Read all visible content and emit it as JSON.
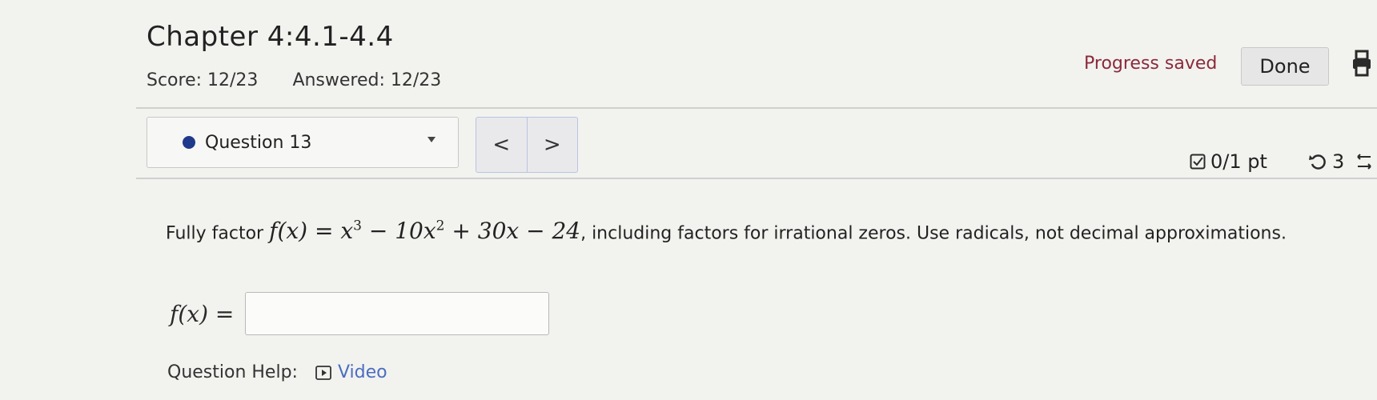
{
  "header": {
    "title": "Chapter 4:4.1-4.4",
    "score": "Score: 12/23",
    "answered": "Answered: 12/23",
    "progress_status": "Progress saved",
    "done_label": "Done"
  },
  "question_nav": {
    "selected": "Question 13",
    "prev_label": "<",
    "next_label": ">"
  },
  "status": {
    "points": "0/1 pt",
    "attempts": "3"
  },
  "question": {
    "prompt_prefix": "Fully factor",
    "expression": "f(x) = x3 − 10x2 + 30x − 24",
    "func": "f(x) = x",
    "exp1": "3",
    "mid": " − 10x",
    "exp2": "2",
    "tail": " + 30x − 24",
    "prompt_suffix": ", including factors for irrational zeros. Use radicals, not decimal approximations."
  },
  "answer": {
    "label": "f(x) =",
    "value": ""
  },
  "help": {
    "label": "Question Help:",
    "video_label": "Video"
  },
  "icons": [
    "print-icon",
    "check-icon",
    "retry-icon",
    "more-icon",
    "video-icon",
    "chevron-down-icon"
  ],
  "colors": {
    "accent": "#1f3a8a",
    "progress_saved": "#8a2a3a",
    "link": "#4a6ec0"
  }
}
